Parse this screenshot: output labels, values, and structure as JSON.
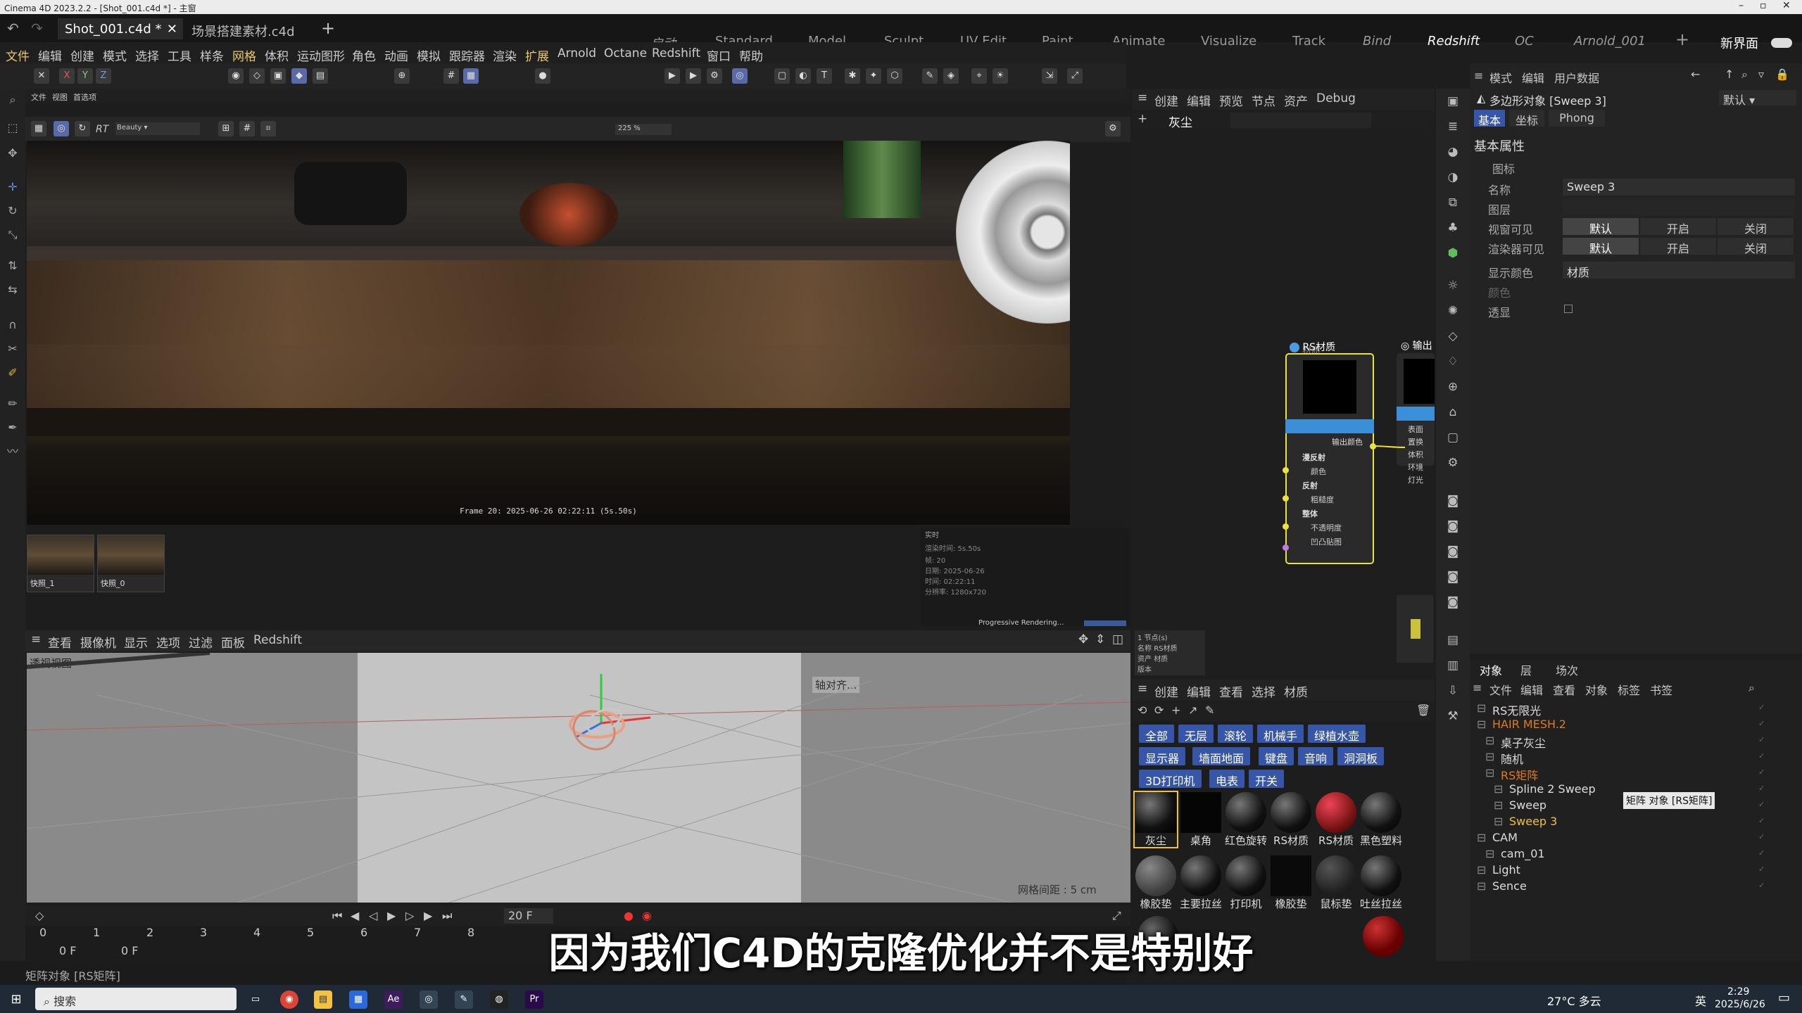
{
  "window": {
    "title": "Cinema 4D 2023.2.2 - [Shot_001.c4d *] - 主窗"
  },
  "doc_tabs": [
    {
      "label": "Shot_001.c4d *",
      "active": true
    },
    {
      "label": "场景搭建素材.c4d",
      "active": false
    }
  ],
  "workspaces": [
    "启动",
    "Standard",
    "Model",
    "Sculpt",
    "UV Edit",
    "Paint",
    "Animate",
    "Visualize",
    "Track",
    "Bind",
    "Redshift",
    "OC",
    "Arnold_001"
  ],
  "new_ui_label": "新界面",
  "menu": [
    "文件",
    "编辑",
    "创建",
    "模式",
    "选择",
    "工具",
    "样条",
    "网格",
    "体积",
    "运动图形",
    "角色",
    "动画",
    "模拟",
    "跟踪器",
    "渲染",
    "扩展",
    "Arnold",
    "Octane",
    "Redshift",
    "窗口",
    "帮助"
  ],
  "render_view": {
    "menu": [
      "文件",
      "视图",
      "首选项"
    ],
    "frame_info": "Frame  20:  2025-06-26  02:22:11  (5s.50s)",
    "snapshots": [
      "快照_1",
      "快照_0"
    ],
    "realtime_label": "实时",
    "progress_label": "Progressive Rendering...",
    "zoom": "225 %",
    "status_lines": [
      "渲染时间: 5s.50s",
      "帧: 20",
      "日期: 2025-06-26",
      "时间: 02:22:11",
      "分辨率: 1280x720"
    ]
  },
  "viewport": {
    "menu": [
      "查看",
      "摄像机",
      "显示",
      "选项",
      "过滤",
      "面板",
      "Redshift"
    ],
    "label": "透视视图",
    "axis_label": "轴对齐...",
    "grid_spacing": "网格间距 : 5 cm"
  },
  "timeline": {
    "frame_field": "20 F",
    "ticks": [
      "0",
      "1",
      "2",
      "3",
      "4",
      "5",
      "6",
      "7",
      "8"
    ],
    "start": "0 F",
    "end": "0 F"
  },
  "status_text": "矩阵对象 [RS矩阵]",
  "node_editor": {
    "menu": [
      "创建",
      "编辑",
      "预览",
      "节点",
      "资产",
      "Debug"
    ],
    "tab": "灰尘",
    "node_group": "材质",
    "rs_material": "RS材质",
    "output": "输出",
    "output_color": "输出颜色",
    "inputs": [
      "漫反射",
      "颜色",
      "反射",
      "粗糙度",
      "整体",
      "不透明度",
      "凹凸贴图"
    ],
    "outputs": [
      "表面",
      "置换",
      "体积",
      "环境",
      "灯光"
    ],
    "info_lines": [
      "1 节点(s)",
      "名称",
      "资产",
      "版本"
    ],
    "info_values": [
      "RS材质",
      "材质"
    ]
  },
  "materials": {
    "menu": [
      "创建",
      "编辑",
      "查看",
      "选择",
      "材质"
    ],
    "categories": [
      "全部",
      "无层",
      "滚轮",
      "机械手",
      "绿植水壶",
      "显示器",
      "墙面地面",
      "键盘",
      "音响",
      "洞洞板",
      "3D打印机",
      "电表",
      "开关"
    ],
    "row1": [
      {
        "label": "灰尘",
        "color": "#111111"
      },
      {
        "label": "桌角",
        "color": "#050505"
      },
      {
        "label": "红色旋转",
        "color": "#1a1a1a"
      },
      {
        "label": "RS材质",
        "color": "#222222"
      },
      {
        "label": "RS材质",
        "color": "#9b1c1c"
      },
      {
        "label": "黑色塑料",
        "color": "#151515"
      }
    ],
    "row2": [
      {
        "label": "橡胶垫",
        "color": "#333333"
      },
      {
        "label": "主要拉丝",
        "color": "#1f1f1f"
      },
      {
        "label": "打印机",
        "color": "#111111"
      },
      {
        "label": "橡胶垫",
        "color": "#0a0a0a"
      },
      {
        "label": "鼠标垫",
        "color": "#2a2a2a"
      },
      {
        "label": "吐丝拉丝",
        "color": "#161616"
      }
    ]
  },
  "attributes": {
    "menu": [
      "模式",
      "编辑",
      "用户数据"
    ],
    "object_title": "多边形对象 [Sweep 3]",
    "default": "默认",
    "tabs": [
      "基本",
      "坐标",
      "Phong"
    ],
    "section": "基本属性",
    "icon_label": "图标",
    "name_label": "名称",
    "name_value": "Sweep 3",
    "layer_label": "图层",
    "viewport_vis": "视窗可见",
    "render_vis": "渲染器可见",
    "opt_default": "默认",
    "opt_on": "开启",
    "opt_off": "关闭",
    "display_color": "显示颜色",
    "display_color_value": "材质",
    "color": "颜色",
    "xray": "透显"
  },
  "objects": {
    "tabs": [
      "对象",
      "层",
      "场次"
    ],
    "menu": [
      "文件",
      "编辑",
      "查看",
      "对象",
      "标签",
      "书签"
    ],
    "items": [
      {
        "name": "RS无限光",
        "indent": 0,
        "color": "#dddddd"
      },
      {
        "name": "HAIR MESH.2",
        "indent": 0,
        "color": "#e07a1e"
      },
      {
        "name": "桌子灰尘",
        "indent": 1,
        "color": "#dddddd"
      },
      {
        "name": "随机",
        "indent": 1,
        "color": "#dddddd"
      },
      {
        "name": "RS矩阵",
        "indent": 1,
        "color": "#e07a1e"
      },
      {
        "name": "Spline 2 Sweep",
        "indent": 2,
        "color": "#dddddd"
      },
      {
        "name": "Sweep",
        "indent": 2,
        "color": "#dddddd"
      },
      {
        "name": "Sweep 3",
        "indent": 2,
        "color": "#f0c040"
      },
      {
        "name": "CAM",
        "indent": 0,
        "color": "#dddddd"
      },
      {
        "name": "cam_01",
        "indent": 1,
        "color": "#dddddd"
      },
      {
        "name": "Light",
        "indent": 0,
        "color": "#dddddd"
      },
      {
        "name": "Sence",
        "indent": 0,
        "color": "#dddddd"
      }
    ],
    "tooltip": "矩阵 对象 [RS矩阵]"
  },
  "subtitle": "因为我们C4D的克隆优化并不是特别好",
  "taskbar": {
    "search": "搜索",
    "weather": "27°C 多云",
    "ime": "英",
    "time": "2:29",
    "date": "2025/6/26"
  },
  "colors": {
    "accent": "#3756a8",
    "node_border": "#e8e23a",
    "highlight": "#f0c040"
  }
}
